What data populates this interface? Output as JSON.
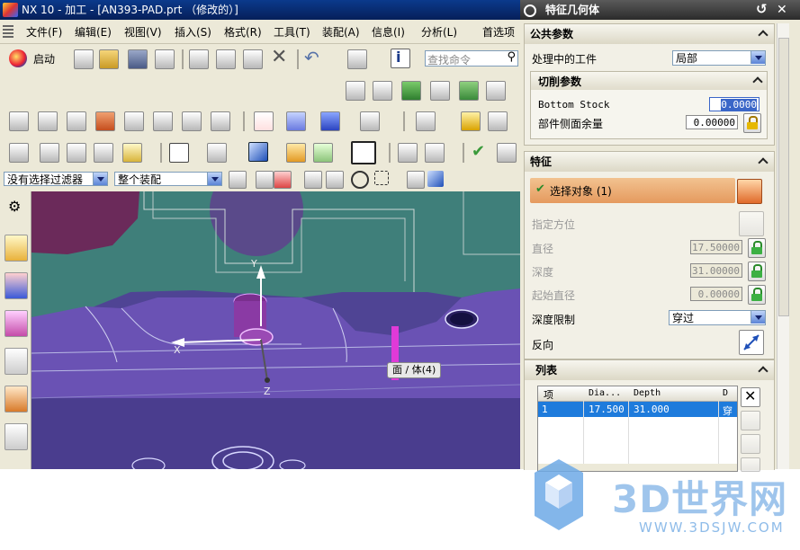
{
  "title_bar": {
    "text": "NX 10 - 加工 - [AN393-PAD.prt （修改的）]"
  },
  "menu_bar": {
    "items": [
      "文件(F)",
      "编辑(E)",
      "视图(V)",
      "插入(S)",
      "格式(R)",
      "工具(T)",
      "装配(A)",
      "信息(I)",
      "分析(L)",
      "首选项"
    ]
  },
  "toolbar": {
    "start_label": "启动",
    "search_placeholder": "查找命令"
  },
  "selection_bar": {
    "filter_value": "没有选择过滤器",
    "scope_value": "整个装配"
  },
  "viewport": {
    "axis_y": "Y",
    "axis_x": "X",
    "axis_z": "Z",
    "tooltip": "面 / 体(4)"
  },
  "dialog": {
    "title": "特征几何体",
    "common": {
      "header": "公共参数",
      "workpiece_label": "处理中的工件",
      "workpiece_value": "局部",
      "cut": {
        "header": "切削参数",
        "bottom_stock_label": "Bottom Stock",
        "bottom_stock_value": "0.0000",
        "side_stock_label": "部件侧面余量",
        "side_stock_value": "0.00000"
      }
    },
    "feature": {
      "header": "特征",
      "select_label": "选择对象 (1)",
      "orient_label": "指定方位",
      "diameter_label": "直径",
      "diameter_value": "17.50000",
      "depth_label": "深度",
      "depth_value": "31.00000",
      "start_diameter_label": "起始直径",
      "start_diameter_value": "0.00000",
      "depth_limit_label": "深度限制",
      "depth_limit_value": "穿过",
      "reverse_label": "反向"
    },
    "list": {
      "header": "列表",
      "columns": [
        "项",
        "Dia...",
        "Depth",
        "D"
      ],
      "rows": [
        [
          "1",
          "17.500",
          "31.000",
          "穿"
        ]
      ]
    }
  },
  "watermark": {
    "brand": "3D世界网",
    "url": "WWW.3DSJW.COM"
  },
  "colors": {
    "title_bg": "#0b3a8c",
    "dialog_title_bg": "#2b2b2b",
    "selected_row": "#1e7bdc",
    "viewport_purple": "#5d4f9c",
    "viewport_green": "#3f7f7a",
    "select_highlight": "#e9a86a"
  }
}
